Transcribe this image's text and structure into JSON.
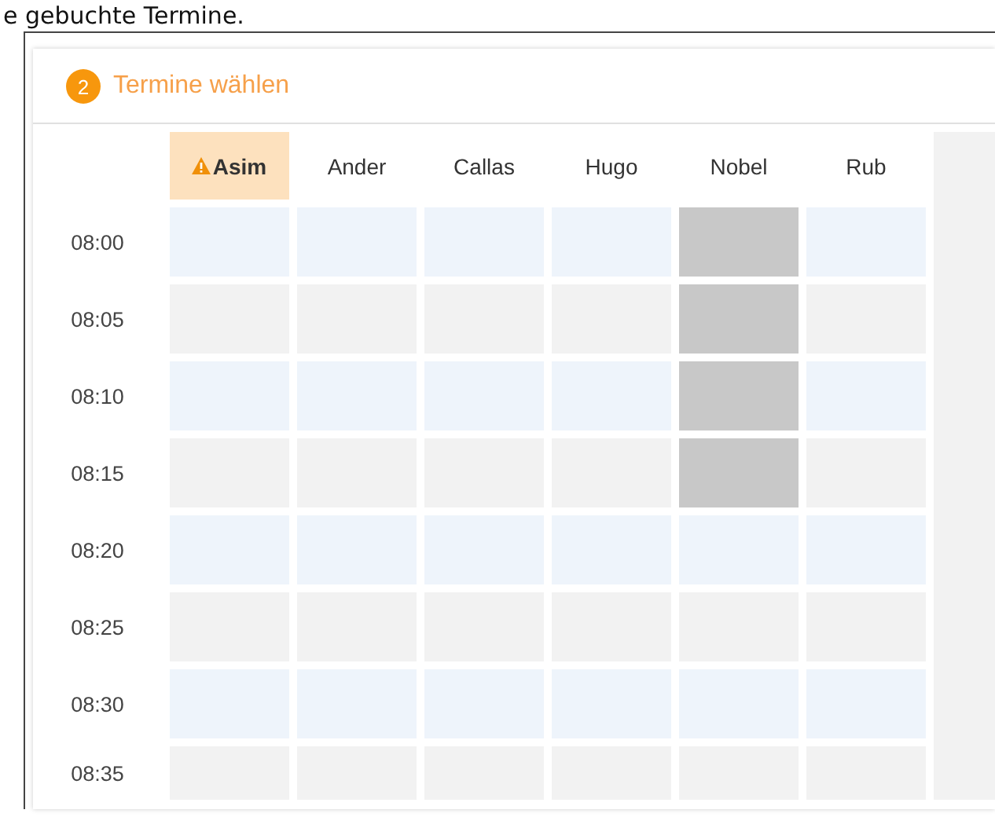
{
  "caption": "e gebuchte Termine.",
  "step": {
    "number": "2",
    "title": "Termine wählen"
  },
  "columns": [
    {
      "name": "Asim",
      "warning": true,
      "selected": true
    },
    {
      "name": "Ander",
      "warning": false,
      "selected": false
    },
    {
      "name": "Callas",
      "warning": false,
      "selected": false
    },
    {
      "name": "Hugo",
      "warning": false,
      "selected": false
    },
    {
      "name": "Nobel",
      "warning": false,
      "selected": false
    },
    {
      "name": "Rub",
      "warning": false,
      "selected": false
    }
  ],
  "rows": [
    {
      "time": "08:00",
      "booked": [
        false,
        false,
        false,
        false,
        true,
        false
      ]
    },
    {
      "time": "08:05",
      "booked": [
        false,
        false,
        false,
        false,
        true,
        false
      ]
    },
    {
      "time": "08:10",
      "booked": [
        false,
        false,
        false,
        false,
        true,
        false
      ]
    },
    {
      "time": "08:15",
      "booked": [
        false,
        false,
        false,
        false,
        true,
        false
      ]
    },
    {
      "time": "08:20",
      "booked": [
        false,
        false,
        false,
        false,
        false,
        false
      ]
    },
    {
      "time": "08:25",
      "booked": [
        false,
        false,
        false,
        false,
        false,
        false
      ]
    },
    {
      "time": "08:30",
      "booked": [
        false,
        false,
        false,
        false,
        false,
        false
      ]
    },
    {
      "time": "08:35",
      "booked": [
        false,
        false,
        false,
        false,
        false,
        false
      ]
    }
  ]
}
